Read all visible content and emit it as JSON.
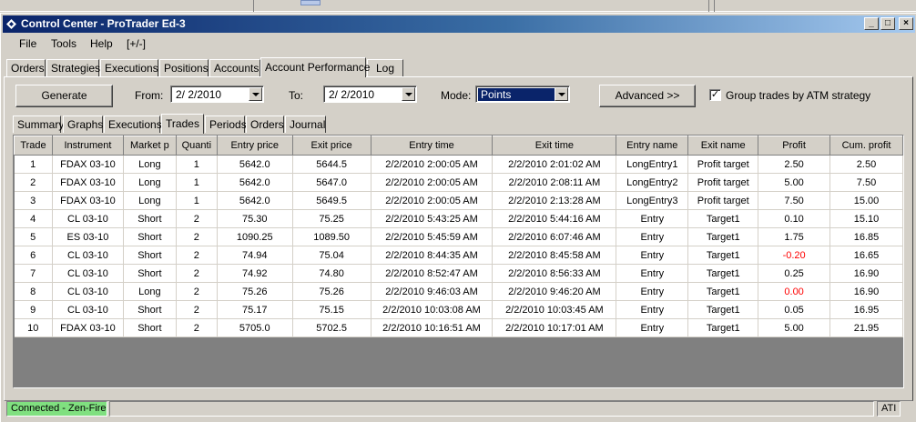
{
  "window": {
    "title": "Control Center - ProTrader Ed-3"
  },
  "title_buttons": {
    "minimize": "_",
    "maximize": "□",
    "close": "×"
  },
  "menu": [
    "File",
    "Tools",
    "Help",
    "[+/-]"
  ],
  "main_tabs": [
    "Orders",
    "Strategies",
    "Executions",
    "Positions",
    "Accounts",
    "Account Performance",
    "Log"
  ],
  "controls": {
    "generate": "Generate",
    "from_label": "From:",
    "from_value": "2/  2/2010",
    "to_label": "To:",
    "to_value": "2/  2/2010",
    "mode_label": "Mode:",
    "mode_value": "Points",
    "advanced": "Advanced >>",
    "group_checked": "✓",
    "group_label": "Group trades by ATM strategy"
  },
  "sub_tabs": [
    "Summary",
    "Graphs",
    "Executions",
    "Trades",
    "Periods",
    "Orders",
    "Journal"
  ],
  "columns": [
    "Trade",
    "Instrument",
    "Market p",
    "Quanti",
    "Entry price",
    "Exit price",
    "Entry time",
    "Exit time",
    "Entry name",
    "Exit name",
    "Profit",
    "Cum. profit"
  ],
  "rows": [
    [
      "1",
      "FDAX 03-10",
      "Long",
      "1",
      "5642.0",
      "5644.5",
      "2/2/2010 2:00:05 AM",
      "2/2/2010 2:01:02 AM",
      "LongEntry1",
      "Profit target",
      "2.50",
      "2.50"
    ],
    [
      "2",
      "FDAX 03-10",
      "Long",
      "1",
      "5642.0",
      "5647.0",
      "2/2/2010 2:00:05 AM",
      "2/2/2010 2:08:11 AM",
      "LongEntry2",
      "Profit target",
      "5.00",
      "7.50"
    ],
    [
      "3",
      "FDAX 03-10",
      "Long",
      "1",
      "5642.0",
      "5649.5",
      "2/2/2010 2:00:05 AM",
      "2/2/2010 2:13:28 AM",
      "LongEntry3",
      "Profit target",
      "7.50",
      "15.00"
    ],
    [
      "4",
      "CL 03-10",
      "Short",
      "2",
      "75.30",
      "75.25",
      "2/2/2010 5:43:25 AM",
      "2/2/2010 5:44:16 AM",
      "Entry",
      "Target1",
      "0.10",
      "15.10"
    ],
    [
      "5",
      "ES 03-10",
      "Short",
      "2",
      "1090.25",
      "1089.50",
      "2/2/2010 5:45:59 AM",
      "2/2/2010 6:07:46 AM",
      "Entry",
      "Target1",
      "1.75",
      "16.85"
    ],
    [
      "6",
      "CL 03-10",
      "Short",
      "2",
      "74.94",
      "75.04",
      "2/2/2010 8:44:35 AM",
      "2/2/2010 8:45:58 AM",
      "Entry",
      "Target1",
      "-0.20",
      "16.65"
    ],
    [
      "7",
      "CL 03-10",
      "Short",
      "2",
      "74.92",
      "74.80",
      "2/2/2010 8:52:47 AM",
      "2/2/2010 8:56:33 AM",
      "Entry",
      "Target1",
      "0.25",
      "16.90"
    ],
    [
      "8",
      "CL 03-10",
      "Long",
      "2",
      "75.26",
      "75.26",
      "2/2/2010 9:46:03 AM",
      "2/2/2010 9:46:20 AM",
      "Entry",
      "Target1",
      "0.00",
      "16.90"
    ],
    [
      "9",
      "CL 03-10",
      "Short",
      "2",
      "75.17",
      "75.15",
      "2/2/2010 10:03:08 AM",
      "2/2/2010 10:03:45 AM",
      "Entry",
      "Target1",
      "0.05",
      "16.95"
    ],
    [
      "10",
      "FDAX 03-10",
      "Short",
      "2",
      "5705.0",
      "5702.5",
      "2/2/2010 10:16:51 AM",
      "2/2/2010 10:17:01 AM",
      "Entry",
      "Target1",
      "5.00",
      "21.95"
    ]
  ],
  "status": {
    "connection": "Connected - Zen-Fire",
    "right": "ATI"
  },
  "colors": {
    "title_start": "#0a246a",
    "title_end": "#a6caf0",
    "negative_profit": "#ff0000",
    "connected": "#80e080"
  }
}
